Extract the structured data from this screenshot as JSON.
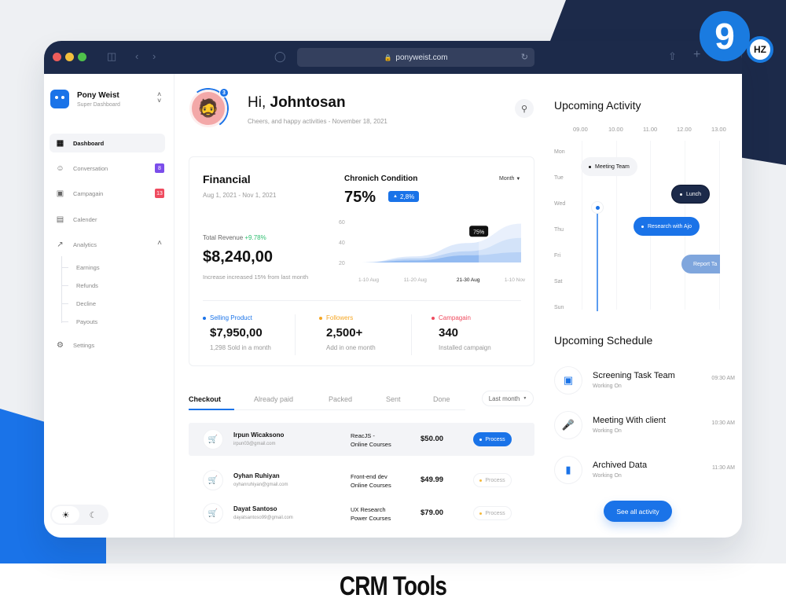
{
  "caption": "CRM Tools",
  "watermark": {
    "main": "9",
    "sub": "HZ"
  },
  "browser": {
    "url": "ponyweist.com",
    "icons": [
      "sidebar-icon",
      "back-icon",
      "forward-icon",
      "shield-icon",
      "lock-icon",
      "reload-icon",
      "share-icon",
      "new-tab-icon"
    ]
  },
  "sidebar": {
    "brand_name": "Pony Weist",
    "brand_sub": "Super Dashboard",
    "items": [
      {
        "label": "Dashboard",
        "icon": "grid-icon",
        "active": true
      },
      {
        "label": "Conversation",
        "icon": "chat-icon",
        "badge": "8",
        "badge_color": "#7b4dea"
      },
      {
        "label": "Campagain",
        "icon": "campaign-icon",
        "badge": "13",
        "badge_color": "#ef4b5f"
      },
      {
        "label": "Calender",
        "icon": "calendar-icon"
      },
      {
        "label": "Analytics",
        "icon": "analytics-icon",
        "expanded": true
      },
      {
        "label": "Settings",
        "icon": "gear-icon"
      }
    ],
    "analytics_sub": [
      "Earnings",
      "Refunds",
      "Decline",
      "Payouts"
    ],
    "theme": {
      "light": "sun-icon",
      "dark": "moon-icon",
      "selected": "light"
    }
  },
  "header": {
    "greeting_prefix": "Hi, ",
    "greeting_name": "Johntosan",
    "subtitle": "Cheers, and happy activities - November 18, 2021",
    "notification_count": "3"
  },
  "financial": {
    "title": "Financial",
    "date_range": "Aug 1, 2021 - Nov 1, 2021",
    "revenue_label": "Total Revenue ",
    "revenue_change": "+9.78%",
    "revenue_value": "$8,240,00",
    "revenue_note": "Increase increased 15% from last month",
    "chronic": {
      "title": "Chronich Condition",
      "value": "75%",
      "change": "2,8%",
      "period": "Month",
      "tooltip": "75%"
    },
    "stats": [
      {
        "label": "Selling Product",
        "value": "$7,950,00",
        "note": "1,298 Sold in a month",
        "color": "#1a73e8"
      },
      {
        "label": "Followers",
        "value": "2,500+",
        "note": "Add in one month",
        "color": "#f5a623"
      },
      {
        "label": "Campagain",
        "value": "340",
        "note": "Installed campaign",
        "color": "#ef4b5f"
      }
    ]
  },
  "chart_data": {
    "type": "area",
    "title": "Chronich Condition",
    "categories": [
      "1-10 Aug",
      "11-20 Aug",
      "21-30 Aug",
      "1-10 Nov"
    ],
    "highlighted_category": "21-30 Aug",
    "y_ticks": [
      20,
      40,
      60
    ],
    "ylim": [
      20,
      60
    ],
    "x": [
      0,
      1,
      2,
      3
    ],
    "series": [
      {
        "name": "upper",
        "values": [
          20,
          26,
          39,
          58
        ]
      },
      {
        "name": "middle",
        "values": [
          20,
          24,
          31,
          44
        ]
      },
      {
        "name": "lower",
        "values": [
          20,
          22,
          27,
          30
        ]
      }
    ],
    "tooltip": {
      "at": "21-30 Aug",
      "label": "75%"
    },
    "grid": false
  },
  "orders": {
    "tabs": [
      "Checkout",
      "Already paid",
      "Packed",
      "Sent",
      "Done"
    ],
    "active_tab": "Checkout",
    "period": "Last month",
    "rows": [
      {
        "name": "Irpun Wicaksono",
        "email": "irpun03@gmail.com",
        "course1": "ReacJS -",
        "course2": "Online Courses",
        "price": "$50.00",
        "status": "Process",
        "highlight": true
      },
      {
        "name": "Oyhan Ruhiyan",
        "email": "oyhanruhiyan@gmail.com",
        "course1": "Front-end dev",
        "course2": "Online Courses",
        "price": "$49.99",
        "status": "Process",
        "highlight": false
      },
      {
        "name": "Dayat Santoso",
        "email": "dayatsantoso99@gmail.com",
        "course1": "UX Research",
        "course2": "Power Courses",
        "price": "$79.00",
        "status": "Process",
        "highlight": false
      }
    ]
  },
  "activity": {
    "title": "Upcoming Activity",
    "hours": [
      "09.00",
      "10.00",
      "11.00",
      "12.00",
      "13.00"
    ],
    "days": [
      "Mon",
      "Tue",
      "Wed",
      "Thu",
      "Fri",
      "Sat",
      "Sun"
    ],
    "events": [
      {
        "label": "Meeting Team",
        "day": "Mon-Tue",
        "style": "light"
      },
      {
        "label": "Lunch",
        "day": "Tue-Wed",
        "style": "dark"
      },
      {
        "label": "Research with Ajo",
        "day": "Wed-Thu",
        "style": "blue"
      },
      {
        "label": "Report Ta",
        "day": "Fri",
        "style": "muted"
      }
    ]
  },
  "schedule": {
    "title": "Upcoming Schedule",
    "items": [
      {
        "title": "Screening Task Team",
        "sub": "Working On",
        "time": "09:30 AM",
        "icon": "screening-icon"
      },
      {
        "title": "Meeting With client",
        "sub": "Working On",
        "time": "10:30 AM",
        "icon": "microphone-icon"
      },
      {
        "title": "Archived Data",
        "sub": "Working On",
        "time": "11:30 AM",
        "icon": "archive-icon"
      }
    ],
    "see_all": "See all activity"
  }
}
